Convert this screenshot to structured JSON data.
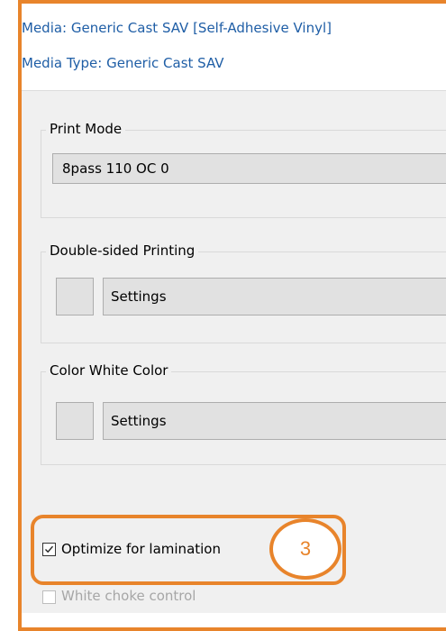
{
  "header": {
    "media": "Media: Generic Cast SAV [Self-Adhesive Vinyl]",
    "media_type": "Media Type: Generic Cast SAV"
  },
  "print_mode": {
    "title": "Print Mode",
    "selected": "8pass 110 OC 0"
  },
  "double_sided": {
    "title": "Double-sided Printing",
    "button": "Settings"
  },
  "color_white": {
    "title": "Color White Color",
    "button": "Settings"
  },
  "options": {
    "optimize_lamination": {
      "label": "Optimize for lamination",
      "checked": true
    },
    "white_choke": {
      "label": "White choke control",
      "checked": false,
      "disabled": true
    }
  },
  "callout": {
    "number": "3",
    "color": "#e8842b"
  }
}
